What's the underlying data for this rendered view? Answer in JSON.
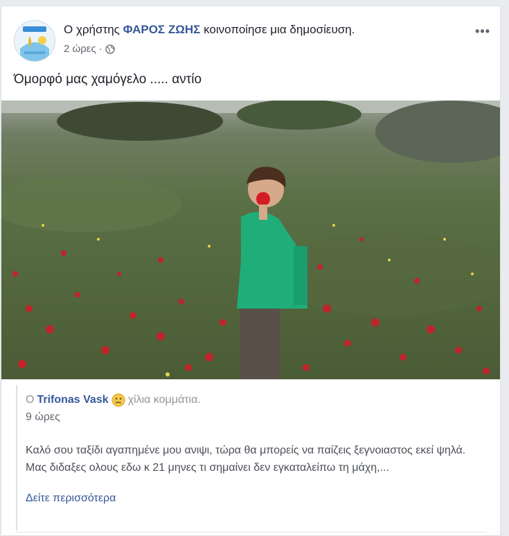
{
  "post": {
    "prefix": "Ο χρήστης",
    "actor": "ΦΑΡΟΣ ΖΩΗΣ",
    "action": "κοινοποίησε μια δημοσίευση.",
    "time": "2 ώρες",
    "audience_icon": "globe-icon",
    "more_icon": "•••",
    "text": "Όμορφό μας χαμόγελο ..... αντίο"
  },
  "shared_post": {
    "prefix": "Ο",
    "author": "Trifonas Vask",
    "feeling_icon": "crying-face-emoji",
    "feeling": "χίλια κομμάτια.",
    "time": "9 ώρες",
    "body": "Καλό σου ταξίδι αγαπημένε μου ανιψι, τώρα θα μπορείς να παίζεις ξεγνοιαστος εκεί ψηλά. Μας διδαξες ολους εδω κ 21 μηνες τι σημαίνει δεν εγκαταλείπω τη μάχη,...",
    "see_more": "Δείτε περισσότερα"
  },
  "colors": {
    "link_blue": "#365899",
    "meta_gray": "#606770",
    "card_bg": "#ffffff",
    "page_bg": "#e9ebee"
  }
}
